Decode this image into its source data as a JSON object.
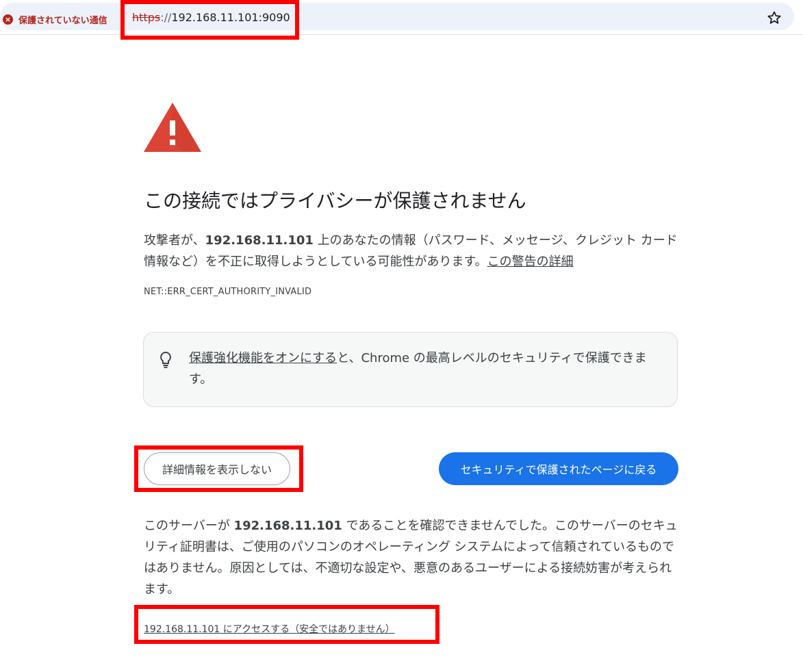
{
  "browser": {
    "security_label": "保護されていない通信",
    "url_scheme": "https",
    "url_separator": "://",
    "url_rest": "192.168.11.101:9090"
  },
  "interstitial": {
    "heading": "この接続ではプライバシーが保護されません",
    "para1_pre": "攻撃者が、",
    "host": "192.168.11.101",
    "para1_post": " 上のあなたの情報（パスワード、メッセージ、クレジット カード情報など）を不正に取得しようとしている可能性があります。",
    "learn_more_link": "この警告の詳細",
    "error_code": "NET::ERR_CERT_AUTHORITY_INVALID",
    "tip_link": "保護強化機能をオンにする",
    "tip_rest": "と、Chrome の最高レベルのセキュリティで保護できます。",
    "hide_details_button": "詳細情報を表示しない",
    "back_to_safety_button": "セキュリティで保護されたページに戻る",
    "para2_pre": "このサーバーが ",
    "para2_post": " であることを確認できませんでした。このサーバーのセキュリティ証明書は、ご使用のパソコンのオペレーティング システムによって信頼されているものではありません。原因としては、不適切な設定や、悪意のあるユーザーによる接続妨害が考えられます。",
    "proceed_link": "192.168.11.101 にアクセスする（安全ではありません）"
  },
  "colors": {
    "danger": "#b3261e",
    "primary_button": "#1a73e8",
    "annotation": "#ff0000",
    "warning_triangle": "#db4437"
  }
}
